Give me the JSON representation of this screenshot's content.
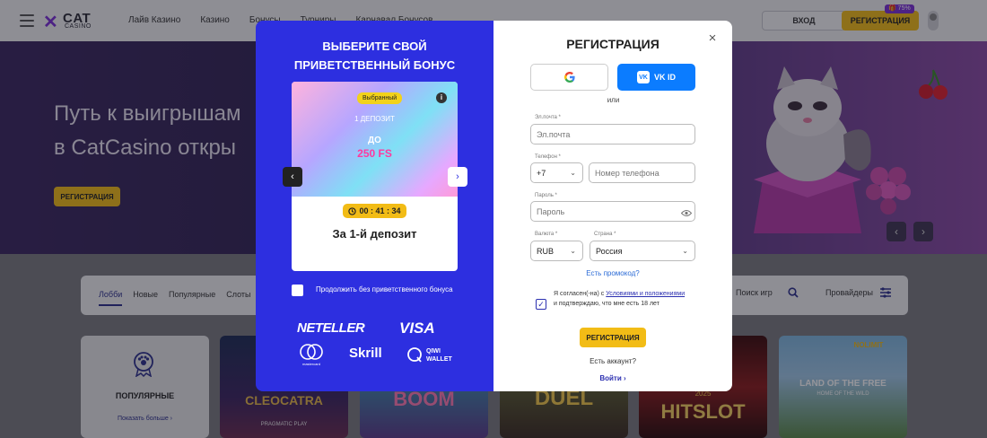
{
  "header": {
    "logo_cat": "CAT",
    "logo_casino": "CASINO",
    "nav": [
      "Лайв Казино",
      "Казино",
      "Бонусы",
      "Турниры",
      "Карнавал Бонусов"
    ],
    "login_label": "ВХОД",
    "register_label": "РЕГИСТРАЦИЯ",
    "promo_badge": "75%"
  },
  "hero": {
    "title_line1": "Путь к выигрышам",
    "title_line2": "в CatCasino откры",
    "cta_label": "РЕГИСТРАЦИЯ",
    "prev": "‹",
    "next": "›"
  },
  "lobby": {
    "tabs": [
      "Лобби",
      "Новые",
      "Популярные",
      "Слоты"
    ],
    "search_label": "Поиск игр",
    "providers_label": "Провайдеры"
  },
  "cards": {
    "popular_title": "ПОПУЛЯРНЫЕ",
    "popular_more": "Показать больше ›",
    "games": [
      {
        "title": "CLEOCATRA",
        "subtitle": "PRAGMATIC PLAY"
      },
      {
        "title": "BOOM",
        "subtitle": ""
      },
      {
        "title": "DUEL",
        "subtitle": ""
      },
      {
        "title": "HITSLOT",
        "subtitle": "2025"
      },
      {
        "title": "LAND OF THE FREE",
        "subtitle": "HOME OF THE WILD",
        "provider": "NOLIMIT"
      }
    ]
  },
  "modal": {
    "bonus_title_line1": "ВЫБЕРИТЕ СВОЙ",
    "bonus_title_line2": "ПРИВЕТСТВЕННЫЙ БОНУС",
    "bonus_chip": "Выбранный",
    "bonus_info": "i",
    "bonus_deposit": "1 ДЕПОЗИТ",
    "bonus_upto": "ДО",
    "bonus_fs": "250 FS",
    "bonus_timer": "00 : 41 : 34",
    "bonus_for": "За 1-й депозит",
    "arrow_prev": "‹",
    "arrow_next": "›",
    "no_bonus_label": "Продолжить без приветственного бонуса",
    "payments": {
      "neteller": "NETELLER",
      "visa": "VISA",
      "mastercard": "mastercard",
      "skrill": "Skrill",
      "qiwi_line1": "QIWI",
      "qiwi_line2": "WALLET"
    },
    "reg_title": "РЕГИСТРАЦИЯ",
    "close": "×",
    "google_label": "G",
    "vk_logo": "VK",
    "vk_label": "VK ID",
    "or_text": "или",
    "email_label": "Эл.почта *",
    "email_placeholder": "Эл.почта",
    "phone_label": "Телефон *",
    "phone_code": "+7",
    "phone_placeholder": "Номер телефона",
    "password_label": "Пароль *",
    "password_placeholder": "Пароль",
    "currency_label": "Валюта *",
    "currency_value": "RUB",
    "country_label": "Страна *",
    "country_value": "Россия",
    "promo_link": "Есть промокод?",
    "agree_prefix": "Я согласен(-на) с ",
    "agree_link": "Условиями и положениями",
    "agree_suffix": " и подтверждаю, что мне есть 18 лет",
    "submit_label": "РЕГИСТРАЦИЯ",
    "have_account": "Есть аккаунт?",
    "login_link": "Войти ›"
  },
  "colors": {
    "accent_yellow": "#f2bc16",
    "modal_blue": "#2d2fe0",
    "vk_blue": "#0b7cff",
    "brand_purple": "#7b2fd8"
  }
}
